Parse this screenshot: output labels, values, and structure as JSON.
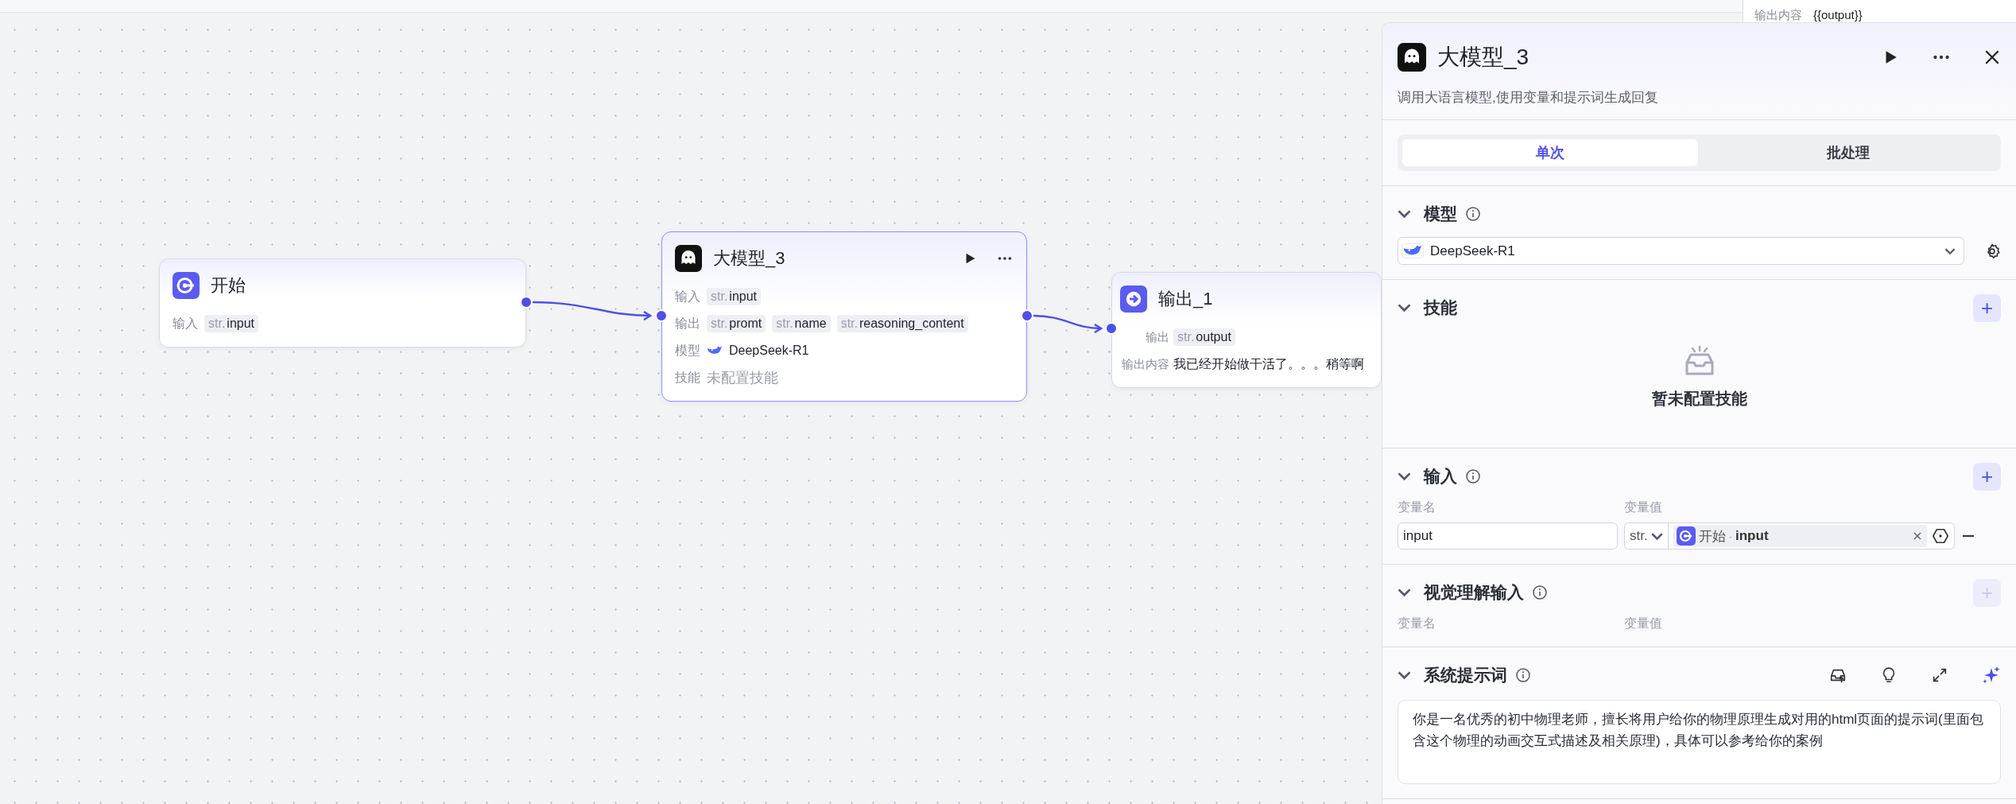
{
  "background_node": {
    "label": "输出内容",
    "value": "{{output}}"
  },
  "canvas": {
    "nodes": [
      {
        "kind": "start",
        "title": "开始",
        "selected": false,
        "rows": [
          {
            "kind": "tags",
            "label": "输入",
            "tags": [
              {
                "type": "str.",
                "name": "input"
              }
            ]
          }
        ]
      },
      {
        "kind": "llm",
        "title": "大模型_3",
        "selected": true,
        "rows": [
          {
            "kind": "tags",
            "label": "输入",
            "tags": [
              {
                "type": "str.",
                "name": "input"
              }
            ]
          },
          {
            "kind": "tags",
            "label": "输出",
            "tags": [
              {
                "type": "str.",
                "name": "promt"
              },
              {
                "type": "str.",
                "name": "name"
              },
              {
                "type": "str.",
                "name": "reasoning_content"
              }
            ]
          },
          {
            "kind": "model",
            "label": "模型",
            "value": "DeepSeek-R1"
          },
          {
            "kind": "muted",
            "label": "技能",
            "value": "未配置技能"
          }
        ]
      },
      {
        "kind": "output",
        "title": "输出_1",
        "selected": false,
        "rows": [
          {
            "kind": "tags",
            "label": "输出",
            "tags": [
              {
                "type": "str.",
                "name": "output"
              }
            ]
          },
          {
            "kind": "text",
            "label": "输出内容",
            "value": "我已经开始做干活了。。。稍等啊"
          }
        ]
      }
    ]
  },
  "panel": {
    "title": "大模型_3",
    "description": "调用大语言模型,使用变量和提示词生成回复",
    "tabs": [
      {
        "label": "单次",
        "selected": true
      },
      {
        "label": "批处理",
        "selected": false
      }
    ],
    "sections": [
      {
        "kind": "model",
        "title": "模型",
        "info": true,
        "value": "DeepSeek-R1"
      },
      {
        "kind": "empty",
        "title": "技能",
        "add_label": "+",
        "add_disabled": false,
        "empty_text": "暂未配置技能"
      },
      {
        "kind": "variables",
        "title": "输入",
        "info": true,
        "add_label": "+",
        "add_disabled": false,
        "columns": [
          "变量名",
          "变量值"
        ],
        "rows": [
          {
            "name": "input",
            "type": "str.",
            "source_node": "开始",
            "separator": "·",
            "source_var": "input"
          }
        ]
      },
      {
        "kind": "variables",
        "title": "视觉理解输入",
        "info": true,
        "add_label": "+",
        "add_disabled": true,
        "columns": [
          "变量名",
          "变量值"
        ]
      },
      {
        "kind": "prompt",
        "title": "系统提示词",
        "info": true,
        "text": "你是一名优秀的初中物理老师，擅长将用户给你的物理原理生成对用的html页面的提示词(里面包含这个物理的动画交互式描述及相关原理)，具体可以参考给你的案例"
      }
    ]
  }
}
